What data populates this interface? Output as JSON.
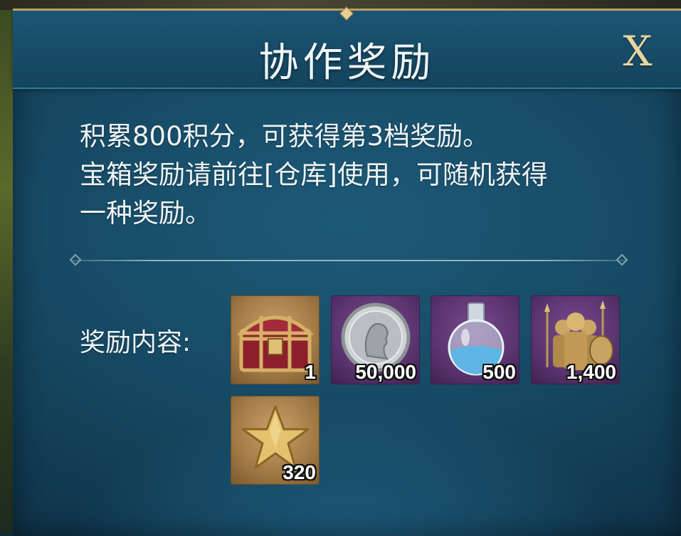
{
  "window": {
    "title": "协作奖励",
    "close_label": "X"
  },
  "description": {
    "line1": "积累800积分，可获得第3档奖励。",
    "line2": "宝箱奖励请前往[仓库]使用，可随机获得",
    "line3": "一种奖励。"
  },
  "rewards": {
    "label": "奖励内容:",
    "items": [
      {
        "icon": "treasure-chest-icon",
        "count": "1",
        "frame": "gold"
      },
      {
        "icon": "silver-coin-icon",
        "count": "50,000",
        "frame": "purple"
      },
      {
        "icon": "potion-flask-icon",
        "count": "500",
        "frame": "purple"
      },
      {
        "icon": "soldiers-icon",
        "count": "1,400",
        "frame": "purple"
      },
      {
        "icon": "gold-star-icon",
        "count": "320",
        "frame": "gold"
      }
    ]
  },
  "colors": {
    "frame_gold": "#c7a86a",
    "panel": "#164862",
    "text": "#eef4f6"
  }
}
